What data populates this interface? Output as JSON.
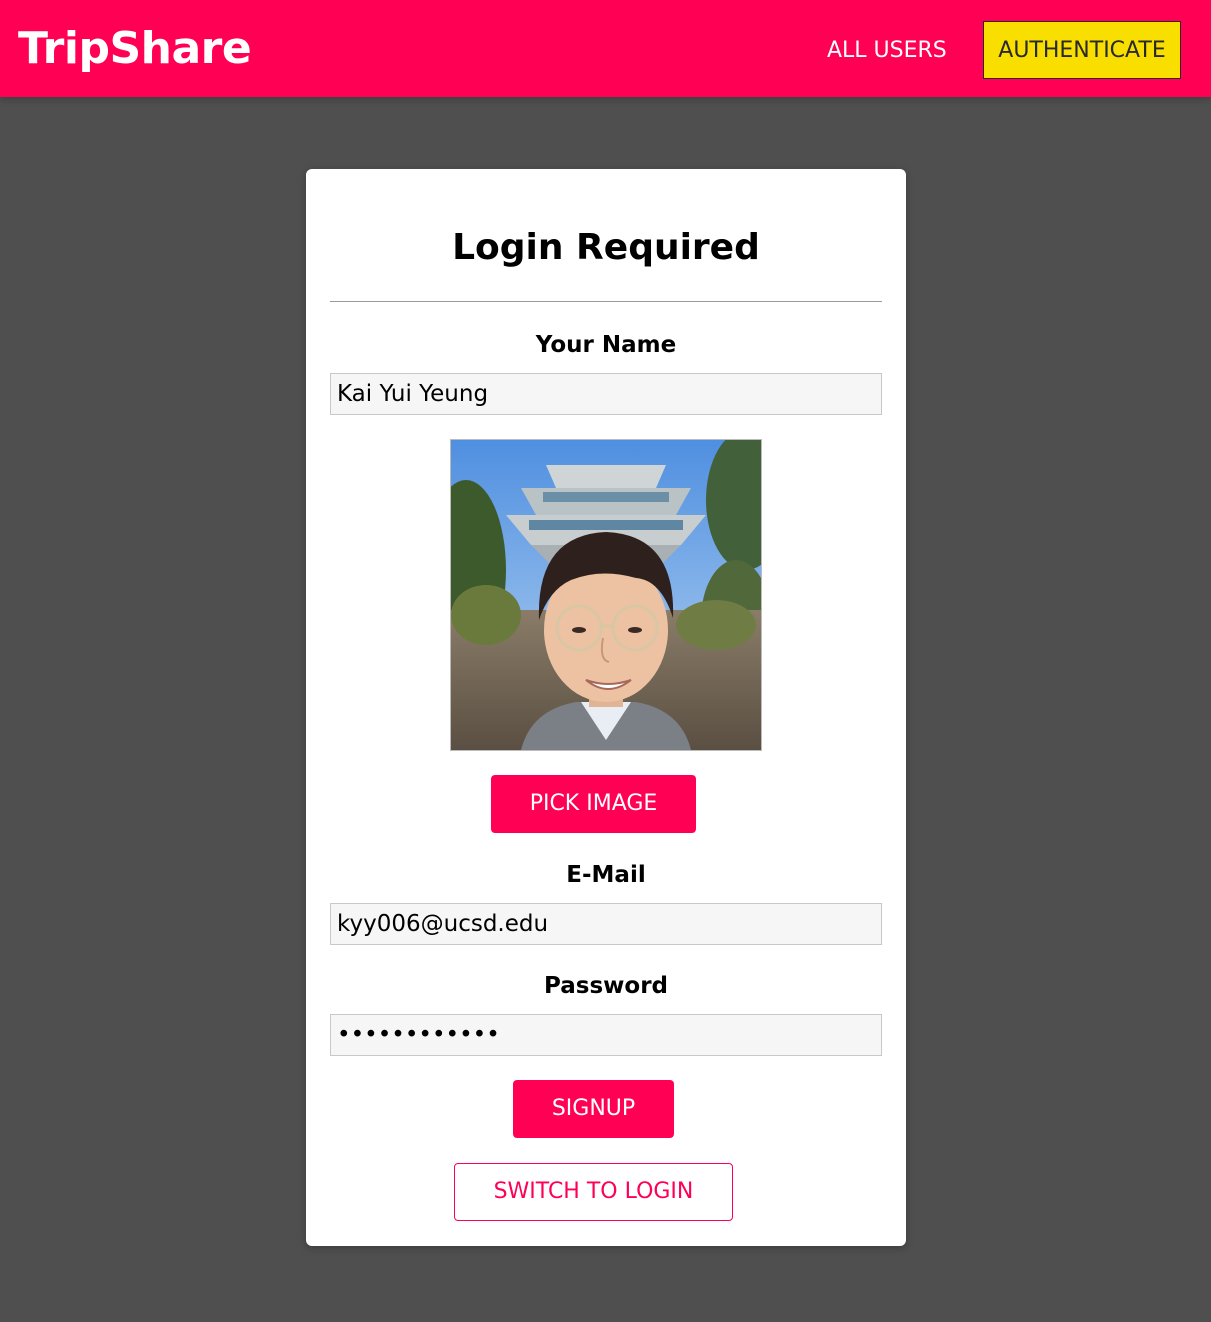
{
  "header": {
    "brand": "TripShare",
    "nav": {
      "all_users": "ALL USERS",
      "authenticate": "AUTHENTICATE"
    }
  },
  "colors": {
    "brand": "#ff0055",
    "auth_active": "#f8df00",
    "page_bg": "#4f4f4f"
  },
  "form": {
    "title": "Login Required",
    "name_label": "Your Name",
    "name_value": "Kai Yui Yeung",
    "pick_image_label": "PICK IMAGE",
    "email_label": "E-Mail",
    "email_value": "kyy006@ucsd.edu",
    "password_label": "Password",
    "password_value": "kaiyuiyeung1",
    "signup_label": "SIGNUP",
    "switch_label": "SWITCH TO LOGIN"
  }
}
